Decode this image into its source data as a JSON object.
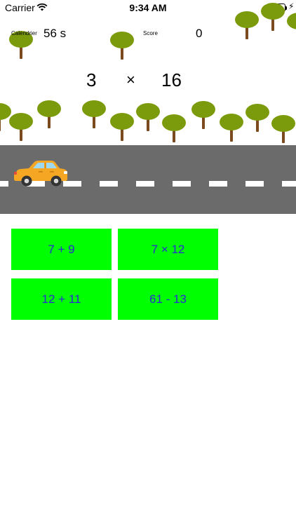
{
  "status_bar": {
    "carrier": "Carrier",
    "time": "9:34 AM",
    "battery_level": 0.9
  },
  "header": {
    "timer_label": "Calendrier",
    "timer_value": "56 s",
    "score_label": "Score",
    "score_value": "0"
  },
  "problem": {
    "left": "3",
    "operator": "×",
    "right": "16"
  },
  "answers": [
    {
      "label": "7 + 9"
    },
    {
      "label": "7 × 12"
    },
    {
      "label": "12 + 11"
    },
    {
      "label": "61 - 13"
    }
  ],
  "colors": {
    "answer_bg": "#00ff00",
    "answer_text": "#2a2ad6",
    "road": "#6b6b6b",
    "tree_crown": "#7c9b0c",
    "tree_trunk": "#7b4a1e",
    "car_body": "#f5a623"
  }
}
